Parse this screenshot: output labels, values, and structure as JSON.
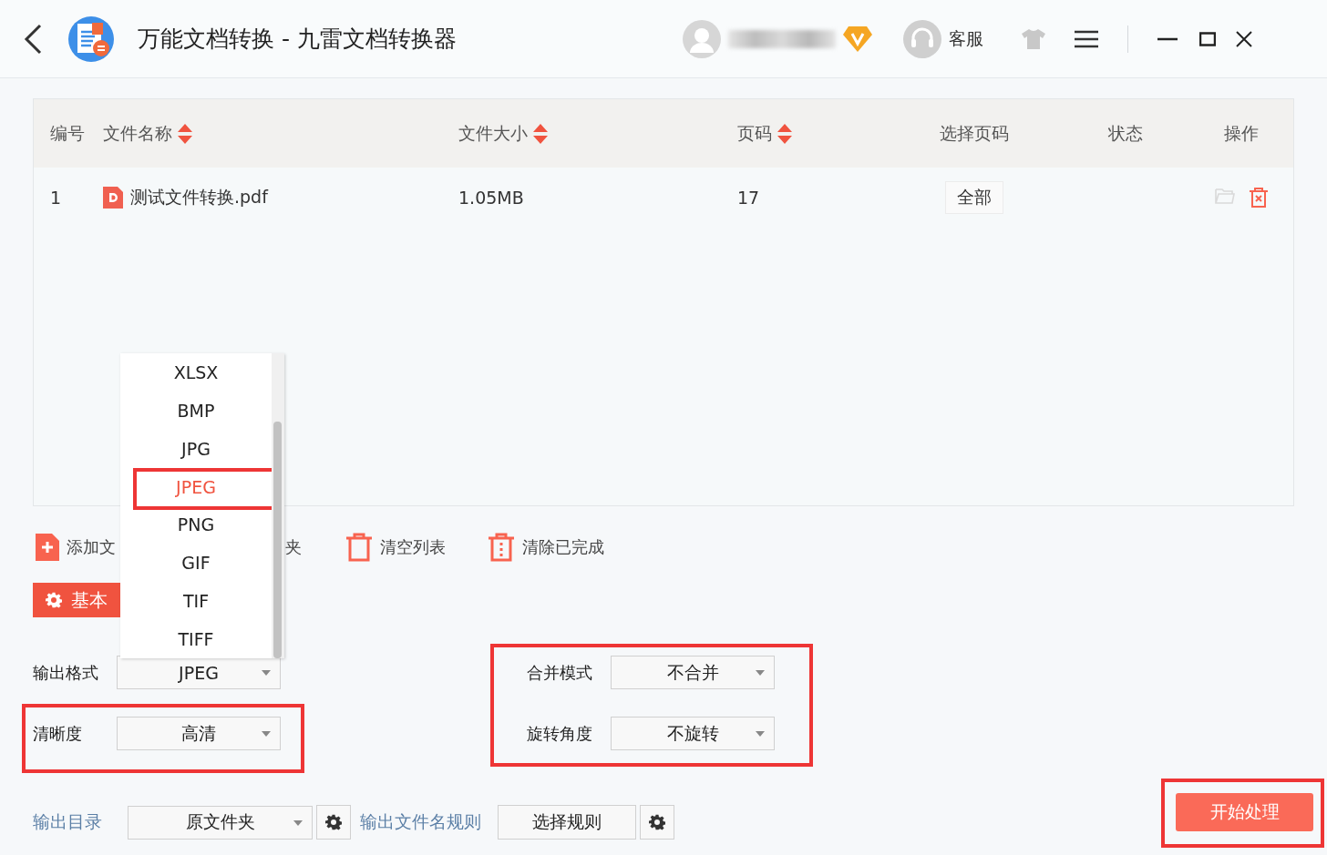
{
  "title_bar": {
    "title": "万能文档转换 - 九雷文档转换器",
    "support_label": "客服"
  },
  "table": {
    "columns": [
      {
        "label": "编号",
        "sortable": false
      },
      {
        "label": "文件名称",
        "sortable": true
      },
      {
        "label": "文件大小",
        "sortable": true
      },
      {
        "label": "页码",
        "sortable": true
      },
      {
        "label": "选择页码",
        "sortable": false
      },
      {
        "label": "状态",
        "sortable": false
      },
      {
        "label": "操作",
        "sortable": false
      }
    ],
    "rows": [
      {
        "index": "1",
        "name": "测试文件转换.pdf",
        "size": "1.05MB",
        "pages": "17",
        "page_select": "全部"
      }
    ]
  },
  "toolbar": [
    {
      "label": "添加文",
      "kind": "add"
    },
    {
      "label": "夹",
      "kind": "plain"
    },
    {
      "label": "清空列表",
      "kind": "clear"
    },
    {
      "label": "清除已完成",
      "kind": "clear-done"
    }
  ],
  "settings_tab": {
    "label": "基本",
    "selected": true
  },
  "format_menu": {
    "items": [
      {
        "label": "XLSX",
        "selected": false
      },
      {
        "label": "BMP",
        "selected": false
      },
      {
        "label": "JPG",
        "selected": false
      },
      {
        "label": "JPEG",
        "selected": true
      },
      {
        "label": "PNG",
        "selected": false
      },
      {
        "label": "GIF",
        "selected": false
      },
      {
        "label": "TIF",
        "selected": false
      },
      {
        "label": "TIFF",
        "selected": false
      }
    ]
  },
  "left_options": [
    {
      "label": "输出格式",
      "value": "JPEG",
      "highlighted": false
    },
    {
      "label": "清晰度",
      "value": "高清",
      "highlighted": true
    }
  ],
  "right_options": [
    {
      "label": "合并模式",
      "value": "不合并",
      "highlighted": true
    },
    {
      "label": "旋转角度",
      "value": "不旋转",
      "highlighted": true
    }
  ],
  "output_dir": {
    "label": "输出目录",
    "value": "原文件夹"
  },
  "name_rule": {
    "label": "输出文件名规则",
    "button": "选择规则"
  },
  "start_button": {
    "label": "开始处理",
    "highlighted": true
  }
}
